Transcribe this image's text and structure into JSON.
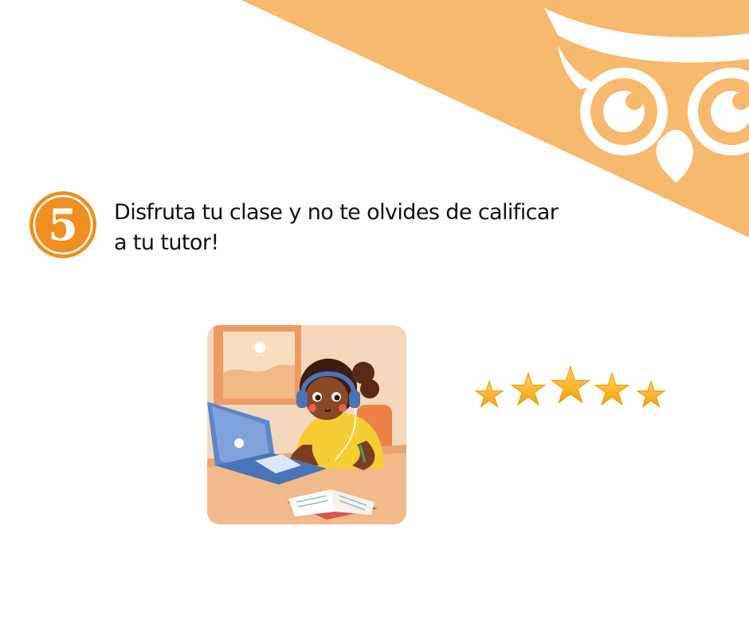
{
  "colors": {
    "brand_orange": "#F7B96E",
    "badge_orange": "#F08E1F",
    "star_gold": "#F8B41A",
    "text": "#111111"
  },
  "step": {
    "number": "5",
    "text_line1": "Disfruta tu clase y no te olvides de calificar",
    "text_line2": "a tu tutor!"
  },
  "decor": {
    "logo_icon": "owl-logo-icon"
  },
  "illustration": {
    "icon": "student-online-class-illustration"
  },
  "rating": {
    "stars": 5,
    "max_stars": 5
  }
}
